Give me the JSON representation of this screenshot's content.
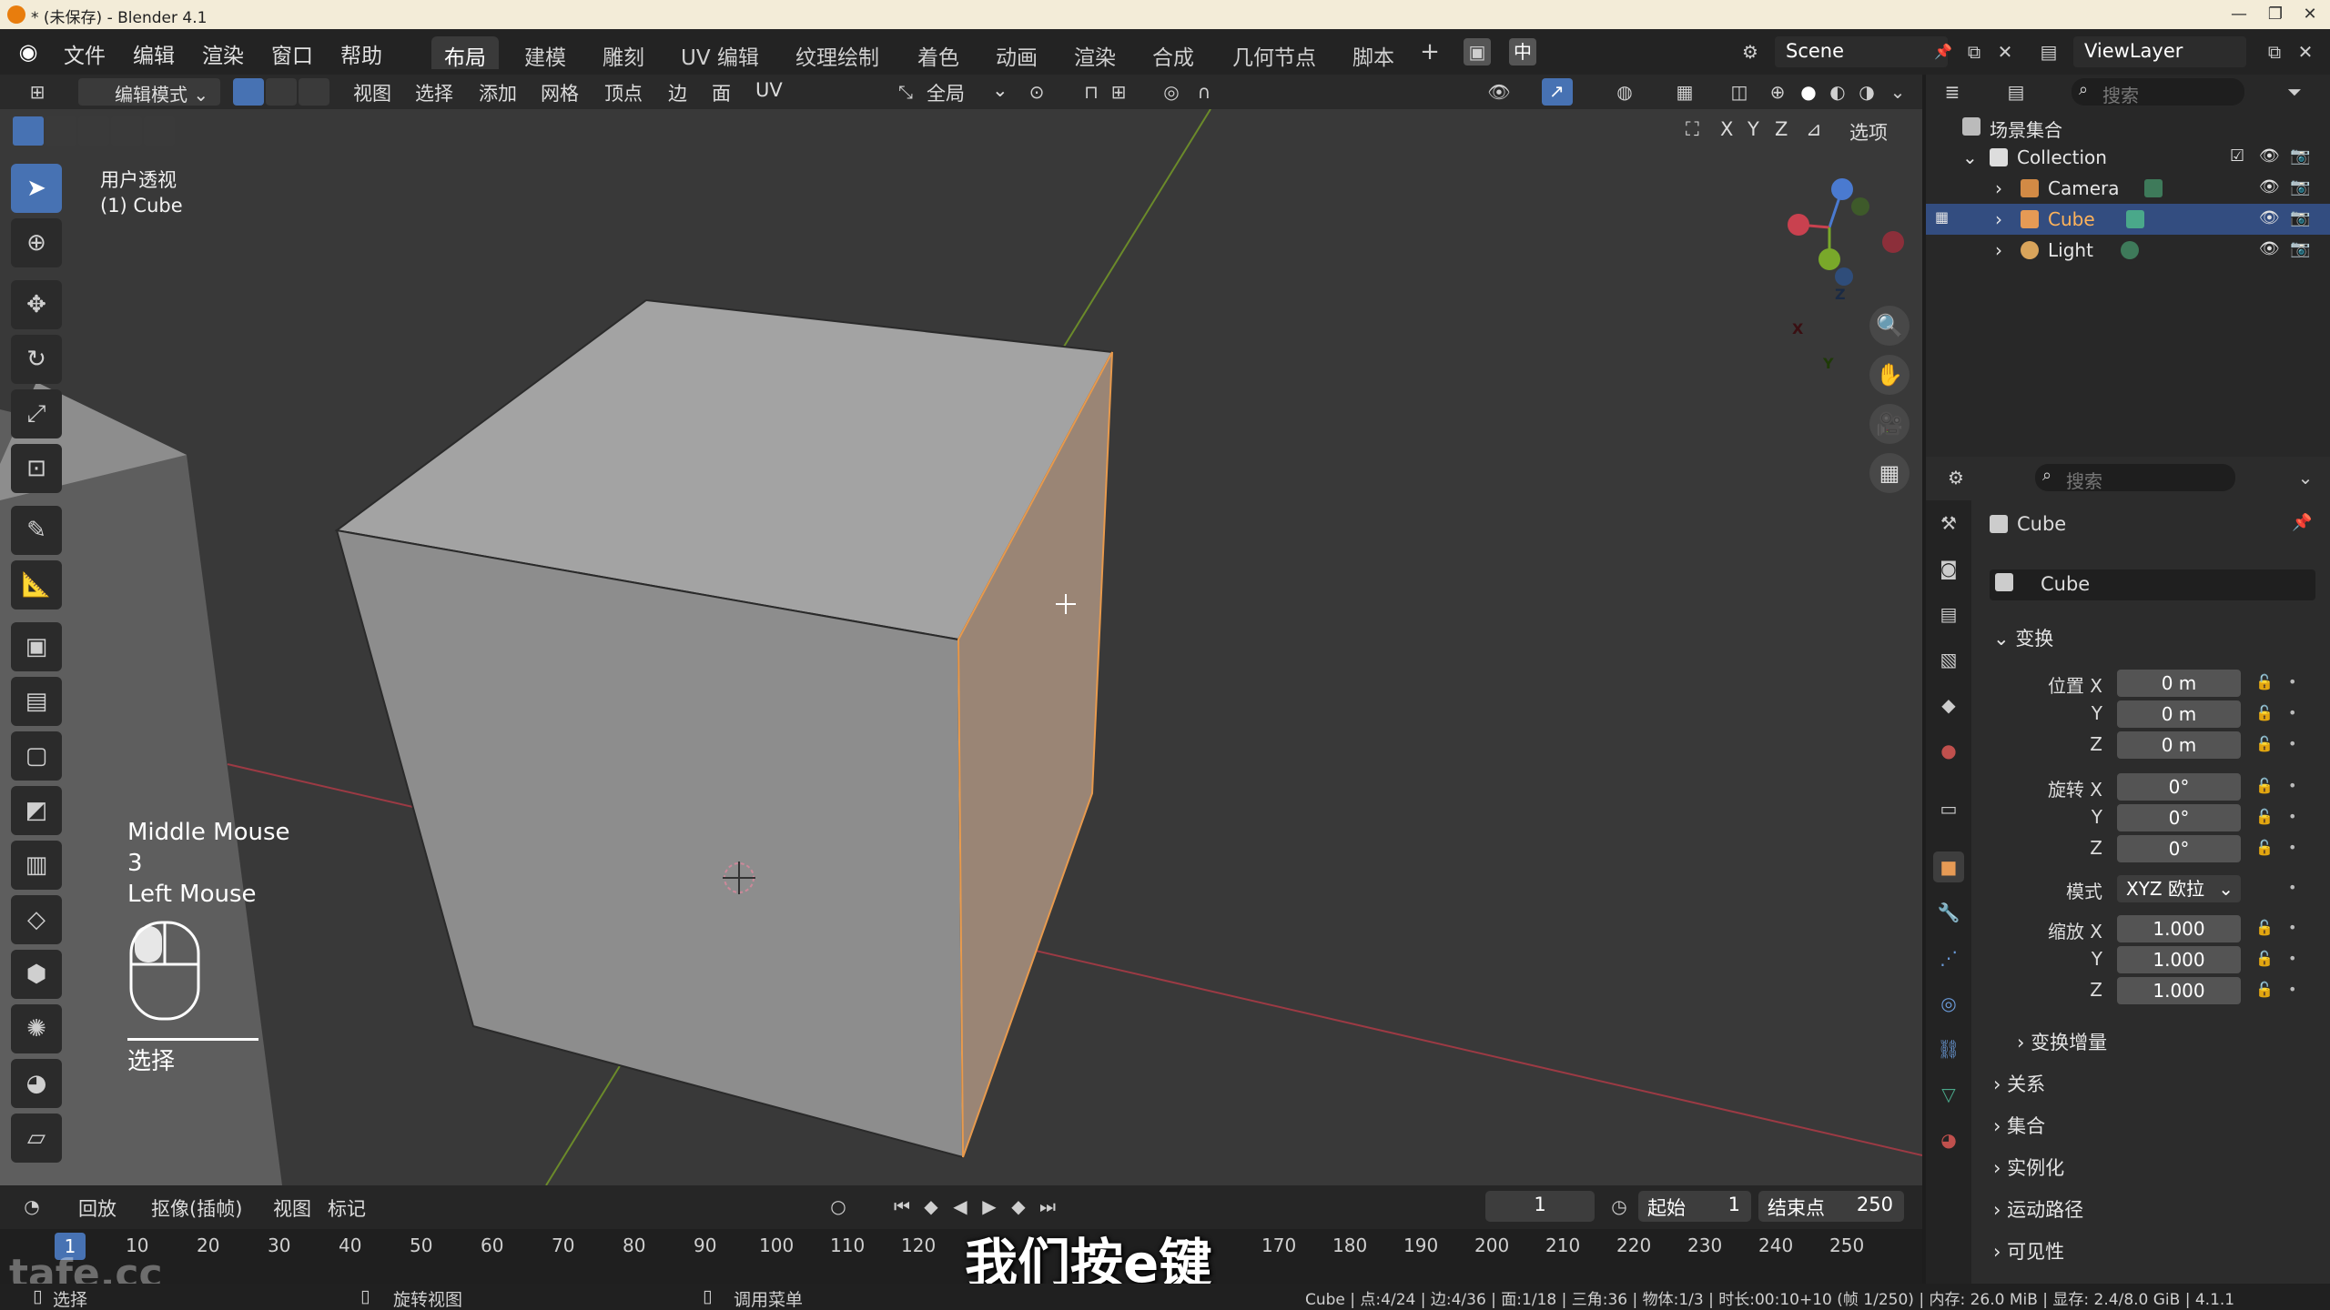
{
  "window": {
    "title": "* (未保存) - Blender 4.1",
    "controls": [
      "—",
      "❐",
      "✕"
    ]
  },
  "menus": [
    "文件",
    "编辑",
    "渲染",
    "窗口",
    "帮助"
  ],
  "workspace_tabs": [
    "布局",
    "建模",
    "雕刻",
    "UV 编辑",
    "纹理绘制",
    "着色",
    "动画",
    "渲染",
    "合成",
    "几何节点",
    "脚本"
  ],
  "active_workspace": "布局",
  "topbar_right": {
    "lang": "中",
    "scene": "Scene",
    "view_layer": "ViewLayer"
  },
  "viewport_header": {
    "mode": "编辑模式",
    "menus": [
      "视图",
      "选择",
      "添加",
      "网格",
      "顶点",
      "边",
      "面",
      "UV"
    ],
    "orientation": "全局",
    "axes": [
      "X",
      "Y",
      "Z"
    ],
    "options": "选项"
  },
  "viewport": {
    "view_name": "用户透视",
    "object_label": "(1) Cube"
  },
  "mouse_hint": {
    "line1": "Middle Mouse",
    "line2": "3",
    "line3": "Left Mouse",
    "action": "选择"
  },
  "gizmo": {
    "x": "X",
    "y": "Y",
    "z": "Z"
  },
  "timeline": {
    "menus": [
      "回放",
      "抠像(插帧)",
      "视图",
      "标记"
    ],
    "current_frame": "1",
    "start_label": "起始",
    "start": "1",
    "end_label": "结束点",
    "end": "250",
    "ruler_current": "1",
    "ticks": [
      "10",
      "20",
      "30",
      "40",
      "50",
      "60",
      "70",
      "80",
      "90",
      "100",
      "110",
      "120",
      "170",
      "180",
      "190",
      "200",
      "210",
      "220",
      "230",
      "240",
      "250"
    ]
  },
  "subtitle": "我们按e键",
  "watermark": "tafe.cc",
  "statusbar": {
    "select": "选择",
    "rotate": "旋转视图",
    "menu": "调用菜单",
    "stats": "Cube | 点:4/24 | 边:4/36 | 面:1/18 | 三角:36 | 物体:1/3 | 时长:00:10+10 (帧 1/250) | 内存: 26.0 MiB | 显存: 2.4/8.0 GiB | 4.1.1"
  },
  "outliner": {
    "search_placeholder": "搜索",
    "root": "场景集合",
    "collection": "Collection",
    "items": [
      {
        "label": "Camera",
        "color": "#d28a45"
      },
      {
        "label": "Cube",
        "color": "#e69a55"
      },
      {
        "label": "Light",
        "color": "#d9a45b"
      }
    ]
  },
  "properties": {
    "search_placeholder": "搜索",
    "object_name": "Cube",
    "data_name": "Cube",
    "transform_label": "变换",
    "location_label": "位置 X",
    "rotation_label": "旋转 X",
    "scale_label": "缩放 X",
    "y_label": "Y",
    "z_label": "Z",
    "location": [
      "0 m",
      "0 m",
      "0 m"
    ],
    "rotation": [
      "0°",
      "0°",
      "0°"
    ],
    "mode_label": "模式",
    "mode_value": "XYZ 欧拉",
    "scale": [
      "1.000",
      "1.000",
      "1.000"
    ],
    "delta_transform": "变换增量",
    "sections": [
      "关系",
      "集合",
      "实例化",
      "运动路径",
      "可见性"
    ]
  },
  "colors": {
    "accent": "#4772b3",
    "selected_face": "#9a8575",
    "cube_face": "#8c8c8c",
    "x_axis": "#9c3a44",
    "y_axis": "#6b8a2a"
  }
}
